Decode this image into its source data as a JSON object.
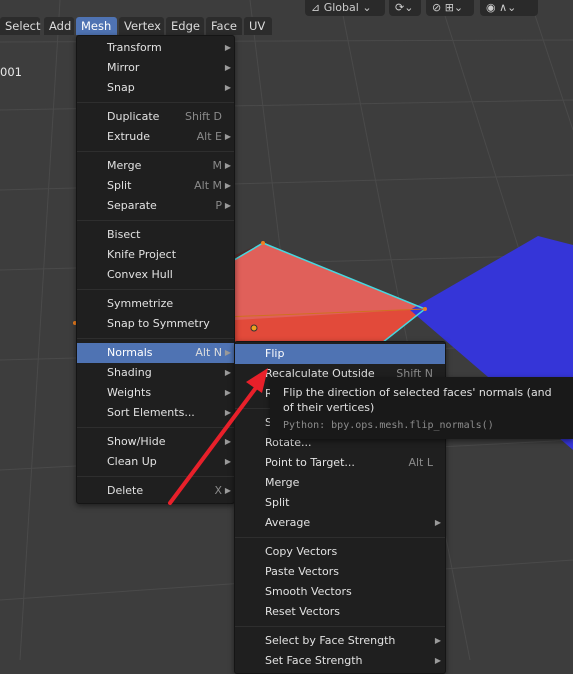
{
  "header": {
    "menus": [
      "Select",
      "Add",
      "Mesh",
      "Vertex",
      "Edge",
      "Face",
      "UV"
    ],
    "active_menu": "Mesh",
    "orientation": "Global"
  },
  "object_label": "001",
  "mesh_menu": [
    {
      "label": "Transform",
      "submenu": true
    },
    {
      "label": "Mirror",
      "submenu": true
    },
    {
      "label": "Snap",
      "submenu": true
    },
    {
      "sep": true
    },
    {
      "label": "Duplicate",
      "shortcut": "Shift D"
    },
    {
      "label": "Extrude",
      "shortcut": "Alt E",
      "submenu": true
    },
    {
      "sep": true
    },
    {
      "label": "Merge",
      "shortcut": "M",
      "submenu": true
    },
    {
      "label": "Split",
      "shortcut": "Alt M",
      "submenu": true
    },
    {
      "label": "Separate",
      "shortcut": "P",
      "submenu": true
    },
    {
      "sep": true
    },
    {
      "label": "Bisect"
    },
    {
      "label": "Knife Project"
    },
    {
      "label": "Convex Hull"
    },
    {
      "sep": true
    },
    {
      "label": "Symmetrize"
    },
    {
      "label": "Snap to Symmetry"
    },
    {
      "sep": true
    },
    {
      "label": "Normals",
      "shortcut": "Alt N",
      "submenu": true,
      "highlighted": true
    },
    {
      "label": "Shading",
      "submenu": true
    },
    {
      "label": "Weights",
      "submenu": true
    },
    {
      "label": "Sort Elements...",
      "submenu": true
    },
    {
      "sep": true
    },
    {
      "label": "Show/Hide",
      "submenu": true
    },
    {
      "label": "Clean Up",
      "submenu": true
    },
    {
      "sep": true
    },
    {
      "label": "Delete",
      "shortcut": "X",
      "submenu": true
    }
  ],
  "normals_menu": [
    {
      "label": "Flip",
      "highlighted": true
    },
    {
      "label": "Recalculate Outside",
      "shortcut": "Shift N"
    },
    {
      "label": "Recalculate Inside",
      "shortcut": "Shift Ctrl N"
    },
    {
      "sep": true
    },
    {
      "label": "Set from Faces"
    },
    {
      "label": "Rotate..."
    },
    {
      "label": "Point to Target...",
      "shortcut": "Alt L"
    },
    {
      "label": "Merge"
    },
    {
      "label": "Split"
    },
    {
      "label": "Average",
      "submenu": true
    },
    {
      "sep": true
    },
    {
      "label": "Copy Vectors"
    },
    {
      "label": "Paste Vectors"
    },
    {
      "label": "Smooth Vectors"
    },
    {
      "label": "Reset Vectors"
    },
    {
      "sep": true
    },
    {
      "label": "Select by Face Strength",
      "submenu": true
    },
    {
      "label": "Set Face Strength",
      "submenu": true
    }
  ],
  "tooltip": {
    "description": "Flip the direction of selected faces' normals (and of their vertices)",
    "python": "Python: bpy.ops.mesh.flip_normals()"
  },
  "colors": {
    "accent": "#4f73b3",
    "menu_bg": "#1f1f1f",
    "viewport_bg": "#3d3d3d",
    "red_face": "#e05a50",
    "blue_face": "#3535d8",
    "annotation_arrow": "#e8202a"
  }
}
